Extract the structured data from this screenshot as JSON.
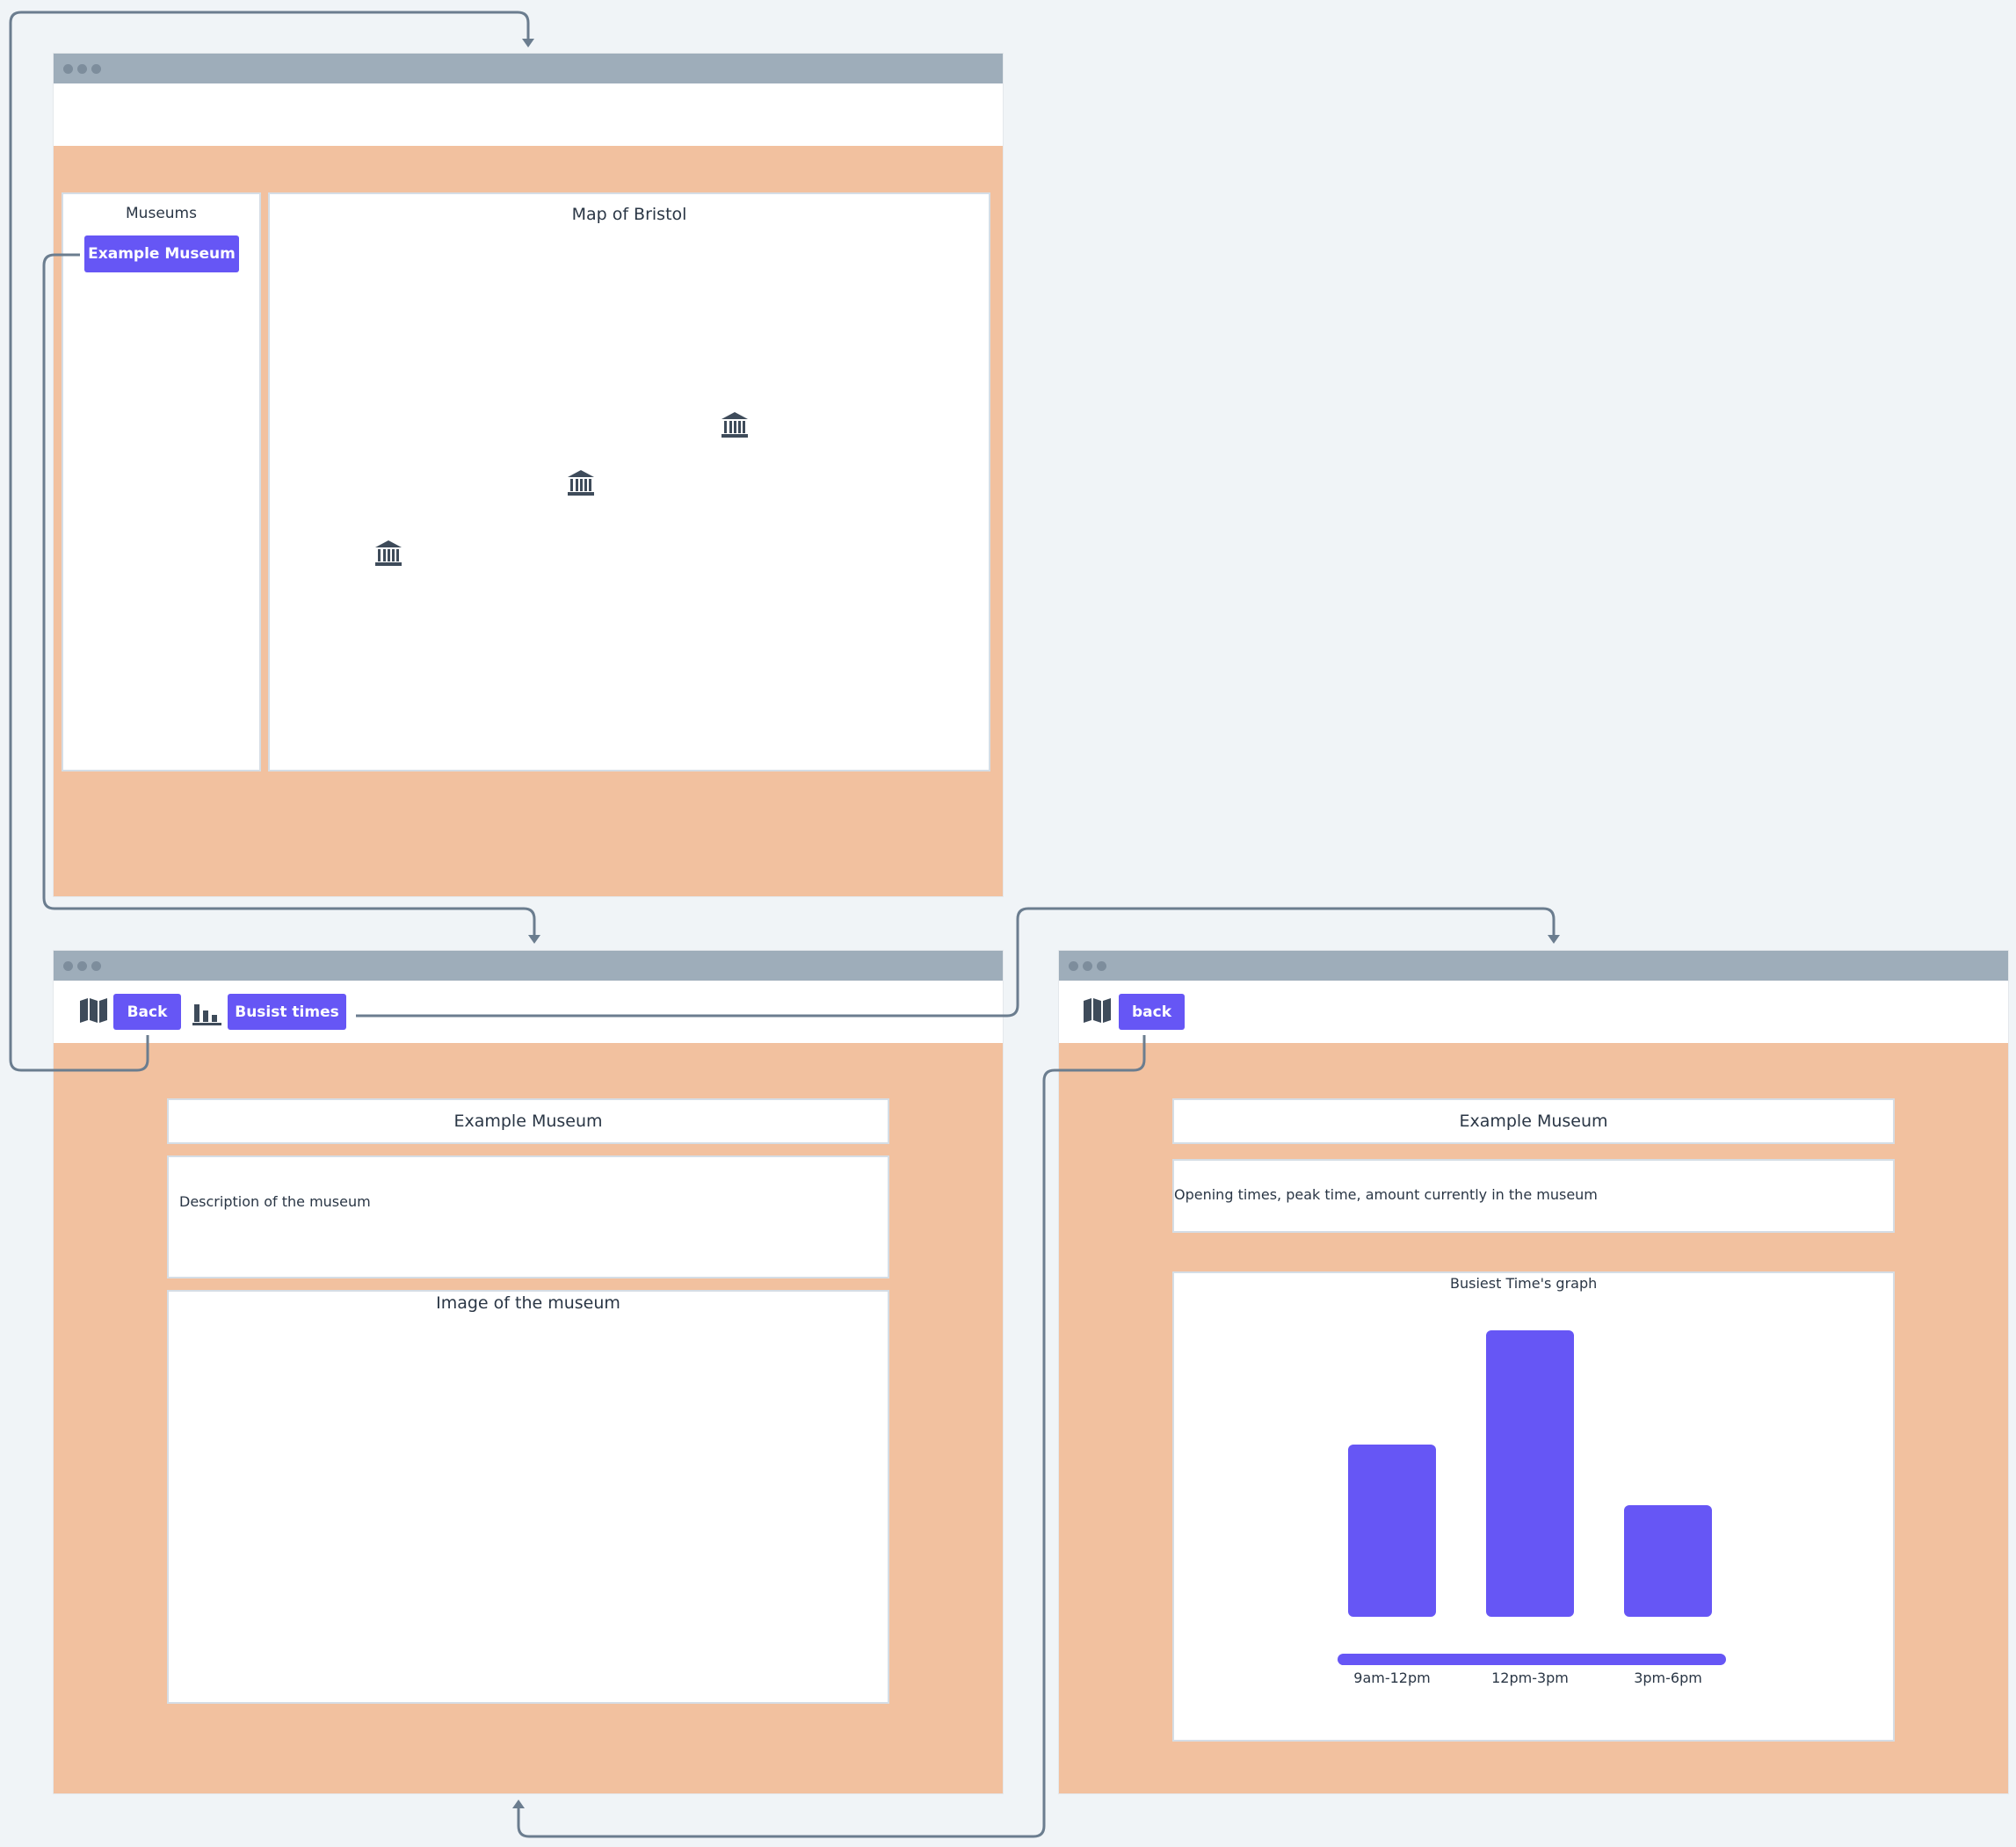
{
  "screen_main": {
    "sidebar": {
      "title": "Museums",
      "museum_button": "Example Museum"
    },
    "map": {
      "title": "Map of Bristol",
      "markers": [
        "museum-icon",
        "museum-icon",
        "museum-icon"
      ]
    }
  },
  "screen_detail": {
    "toolbar": {
      "back_label": "Back",
      "busiest_label": "Busist times"
    },
    "museum_title": "Example Museum",
    "description": "Description of the museum",
    "image_label": "Image of the museum"
  },
  "screen_times": {
    "toolbar": {
      "back_label": "back"
    },
    "museum_title": "Example Museum",
    "info": "Opening times, peak time, amount currently in the museum",
    "graph": {
      "title": "Busiest Time's graph"
    }
  },
  "chart_data": {
    "type": "bar",
    "title": "Busiest Time's graph",
    "categories": [
      "9am-12pm",
      "12pm-3pm",
      "3pm-6pm"
    ],
    "values": [
      0.6,
      1.0,
      0.39
    ],
    "ylim": [
      0,
      1
    ],
    "grid": false,
    "legend": "none"
  },
  "colors": {
    "accent": "#6656f5",
    "frame_background": "#f2c19f",
    "titlebar": "#9eadba",
    "connector": "#6b7d8f",
    "icon": "#3e4b5a"
  }
}
